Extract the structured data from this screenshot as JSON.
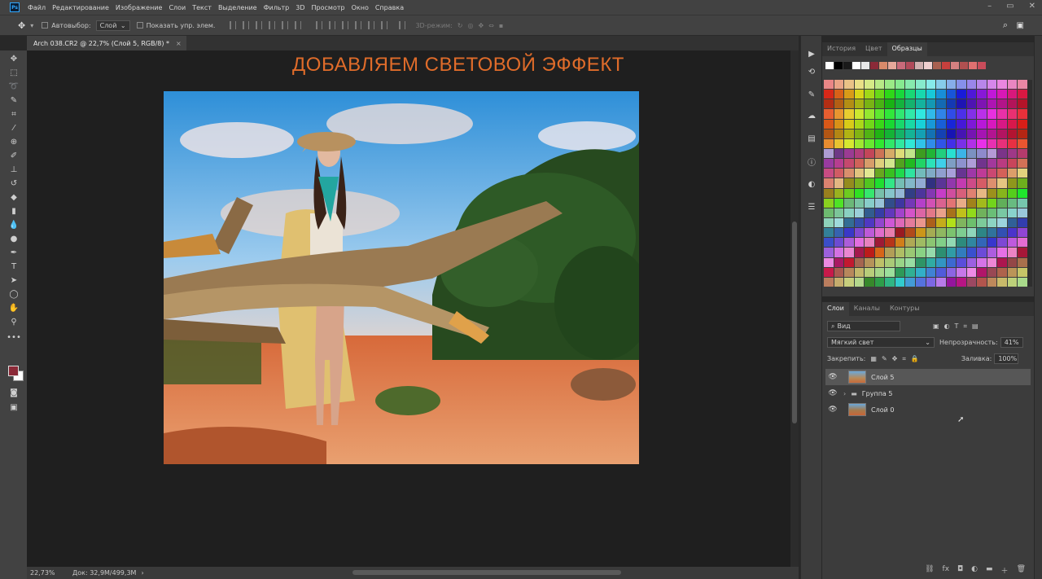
{
  "menu": [
    "Файл",
    "Редактирование",
    "Изображение",
    "Слои",
    "Текст",
    "Выделение",
    "Фильтр",
    "3D",
    "Просмотр",
    "Окно",
    "Справка"
  ],
  "app_logo": "Ps",
  "options": {
    "autoselect_label": "Автовыбор:",
    "autoselect_value": "Слой",
    "show_controls_label": "Показать упр. элем.",
    "mode3d_label": "3D-режим:"
  },
  "doc_tab": {
    "title": "Arch 038.CR2 @ 22,7% (Слой 5, RGB/8) *",
    "close": "×"
  },
  "canvas": {
    "overlay_title": "ДОБАВЛЯЕМ СВЕТОВОЙ ЭФФЕКТ"
  },
  "status": {
    "zoom": "22,73%",
    "doc": "Док: 32,9M/499,3M"
  },
  "swatches_panel": {
    "tabs": [
      "История",
      "Цвет",
      "Образцы"
    ],
    "active_tab": "Образцы"
  },
  "layers_panel": {
    "tabs": [
      "Слои",
      "Каналы",
      "Контуры"
    ],
    "filter_label": "Вид",
    "blend_mode": "Мягкий свет",
    "opacity_label": "Непрозрачность:",
    "opacity_value": "41%",
    "lock_label": "Закрепить:",
    "fill_label": "Заливка:",
    "fill_value": "100%",
    "layers": [
      {
        "name": "Слой 5",
        "selected": true,
        "type": "layer"
      },
      {
        "name": "Группа 5",
        "selected": false,
        "type": "group"
      },
      {
        "name": "Слой 0",
        "selected": false,
        "type": "layer"
      }
    ]
  },
  "colors": {
    "foreground": "#8b2a38",
    "background": "#ffffff",
    "title_orange": "#e06c2a"
  }
}
